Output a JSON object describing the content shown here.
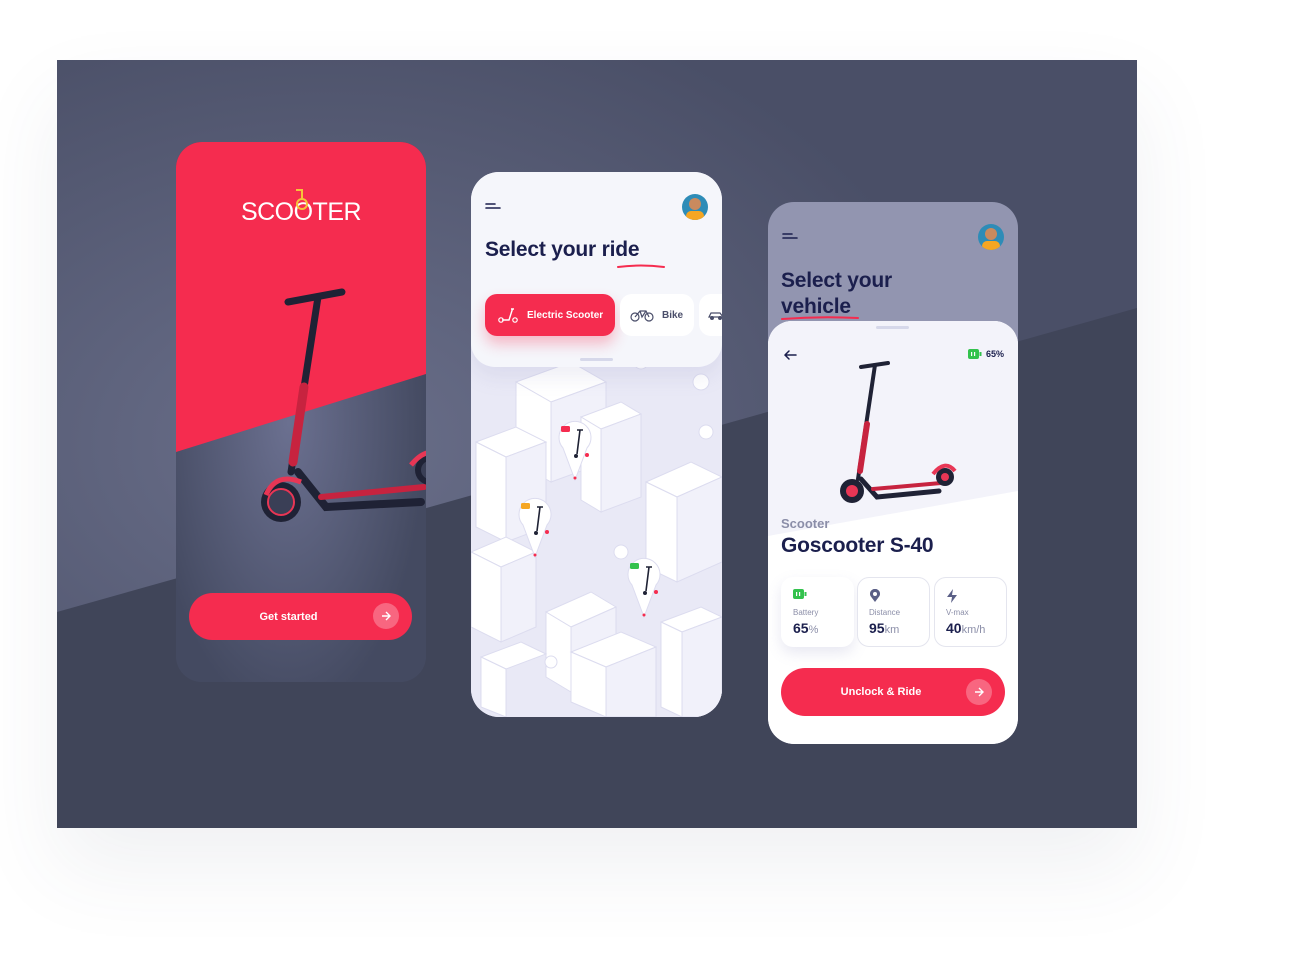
{
  "colors": {
    "accent": "#f52c4f",
    "navy": "#1b1f4d",
    "stage": "#4a4f67",
    "battery": "#33c24d",
    "pin_orange": "#f5a623"
  },
  "splash": {
    "logo_text": "SCOOTER",
    "cta_label": "Get started",
    "cta_icon": "arrow-right-icon"
  },
  "select_ride": {
    "menu_icon": "menu-icon",
    "title_prefix": "Select your",
    "title_highlight": "ride",
    "chips": [
      {
        "label": "Electric Scooter",
        "icon": "scooter-icon",
        "selected": true
      },
      {
        "label": "Bike",
        "icon": "bike-icon",
        "selected": false
      },
      {
        "label": "",
        "icon": "car-icon",
        "selected": false
      }
    ],
    "map_pins": [
      "scooter-pin-red",
      "scooter-pin-orange",
      "scooter-pin-green"
    ]
  },
  "vehicle_detail": {
    "title_prefix": "Select your",
    "title_highlight": "vehicle",
    "battery_badge": "65%",
    "category": "Scooter",
    "name": "Goscooter S-40",
    "stats": [
      {
        "label": "Battery",
        "value": "65",
        "unit": "%",
        "icon": "battery-icon"
      },
      {
        "label": "Distance",
        "value": "95",
        "unit": "km",
        "icon": "location-pin-icon"
      },
      {
        "label": "V-max",
        "value": "40",
        "unit": "km/h",
        "icon": "lightning-icon"
      }
    ],
    "cta_label": "Unclock & Ride",
    "cta_icon": "arrow-right-icon"
  }
}
